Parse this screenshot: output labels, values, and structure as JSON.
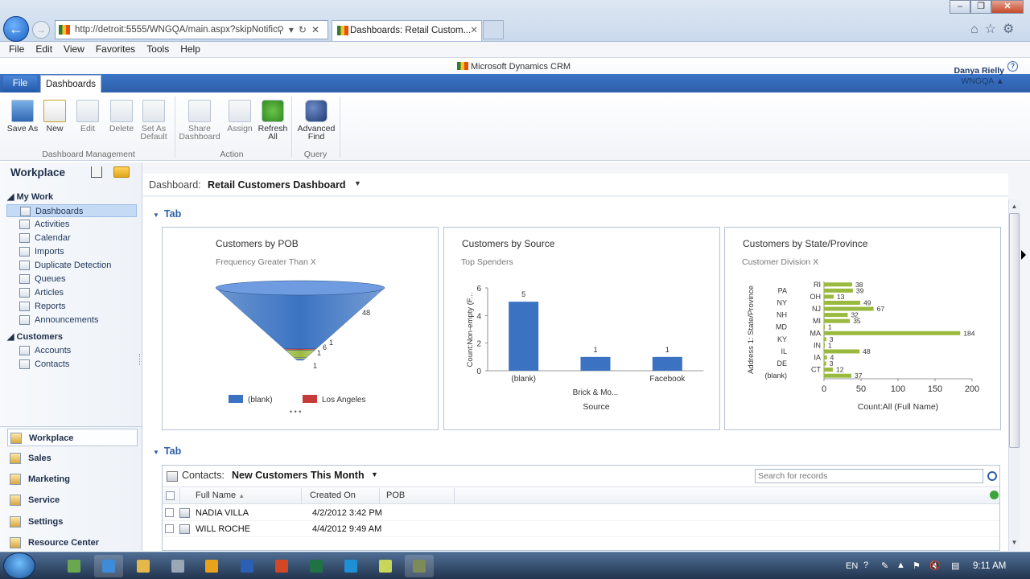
{
  "browser": {
    "url": "http://detroit:5555/WNGQA/main.aspx?skipNotific:",
    "tab_title": "Dashboards: Retail Custom...",
    "menu": [
      "File",
      "Edit",
      "View",
      "Favorites",
      "Tools",
      "Help"
    ]
  },
  "crm": {
    "brand": "Microsoft Dynamics CRM",
    "user_name": "Danya Rielly",
    "org": "WNGQA",
    "ribbon_tabs": {
      "file": "File",
      "dashboards": "Dashboards"
    },
    "ribbon_buttons": [
      {
        "label": "Save As",
        "enabled": true
      },
      {
        "label": "New",
        "enabled": true
      },
      {
        "label": "Edit",
        "enabled": false
      },
      {
        "label": "Delete",
        "enabled": false
      },
      {
        "label": "Set As Default",
        "enabled": false
      },
      {
        "label": "Share Dashboard",
        "enabled": false
      },
      {
        "label": "Assign",
        "enabled": false
      },
      {
        "label": "Refresh All",
        "enabled": true
      },
      {
        "label": "Advanced Find",
        "enabled": true
      }
    ],
    "ribbon_groups": [
      "Dashboard Management",
      "Action",
      "Query"
    ]
  },
  "nav": {
    "title": "Workplace",
    "sections": [
      {
        "name": "My Work",
        "items": [
          "Dashboards",
          "Activities",
          "Calendar",
          "Imports",
          "Duplicate Detection",
          "Queues",
          "Articles",
          "Reports",
          "Announcements"
        ]
      },
      {
        "name": "Customers",
        "items": [
          "Accounts",
          "Contacts"
        ]
      }
    ],
    "selected_item": "Dashboards",
    "areas": [
      "Workplace",
      "Sales",
      "Marketing",
      "Service",
      "Settings",
      "Resource Center"
    ]
  },
  "dashboard": {
    "label": "Dashboard:",
    "name": "Retail Customers Dashboard",
    "tab1": "Tab",
    "tab2": "Tab"
  },
  "chart_data": [
    {
      "type": "funnel",
      "title": "Customers by POB",
      "subtitle": "Frequency Greater Than X",
      "categories": [
        "(blank)",
        "Los Angeles",
        "",
        "",
        ""
      ],
      "values": [
        48,
        1,
        6,
        1,
        1
      ],
      "legend": [
        "(blank)",
        "Los Angeles"
      ],
      "colors": [
        "#3b73c2",
        "#c73a3a",
        "#9aba3f",
        "#d6d14a",
        "#5b8fd6"
      ],
      "more_indicator": "• • •"
    },
    {
      "type": "bar",
      "title": "Customers by Source",
      "subtitle": "Top Spenders",
      "categories": [
        "(blank)",
        "Brick & Mo...",
        "Facebook"
      ],
      "values": [
        5,
        1,
        1
      ],
      "xlabel": "Source",
      "ylabel": "Count:Non-empty (F...",
      "ylim": [
        0,
        6
      ],
      "yticks": [
        0,
        2,
        4,
        6
      ],
      "color": "#3b73c2"
    },
    {
      "type": "bar-horizontal",
      "title": "Customers by State/Province",
      "subtitle": "Customer Division X",
      "categories": [
        "RI",
        "PA",
        "OH",
        "NY",
        "NJ",
        "NH",
        "MI",
        "MD",
        "MA",
        "KY",
        "IN",
        "IL",
        "IA",
        "DE",
        "CT",
        "(blank)"
      ],
      "values": [
        38,
        39,
        13,
        49,
        67,
        32,
        35,
        1,
        184,
        3,
        1,
        48,
        4,
        3,
        12,
        37
      ],
      "xlabel": "Count:All (Full Name)",
      "ylabel": "Address 1: State/Province",
      "xlim": [
        0,
        200
      ],
      "xticks": [
        0,
        50,
        100,
        150,
        200
      ],
      "color": "#9aba3f"
    }
  ],
  "list": {
    "entity_label": "Contacts:",
    "view_name": "New Customers This Month",
    "search_placeholder": "Search for records",
    "columns": [
      "Full Name",
      "Created On",
      "POB"
    ],
    "rows": [
      {
        "full_name": "NADIA VILLA",
        "created_on": "4/2/2012 3:42 PM",
        "pob": ""
      },
      {
        "full_name": "WILL ROCHE",
        "created_on": "4/4/2012 9:49 AM",
        "pob": ""
      }
    ]
  },
  "taskbar": {
    "lang": "EN",
    "time": "9:11 AM",
    "apps": [
      {
        "name": "people-icon",
        "color": "#6aa84f"
      },
      {
        "name": "ie-icon",
        "color": "#3d8bd9"
      },
      {
        "name": "folder-icon",
        "color": "#e5b84b"
      },
      {
        "name": "calc-icon",
        "color": "#9aa7b5"
      },
      {
        "name": "outlook-icon",
        "color": "#e8a21c"
      },
      {
        "name": "word-icon",
        "color": "#2b5fb4"
      },
      {
        "name": "powerpoint-icon",
        "color": "#d24726"
      },
      {
        "name": "excel-icon",
        "color": "#207245"
      },
      {
        "name": "lync-icon",
        "color": "#1f8fd6"
      },
      {
        "name": "notes-icon",
        "color": "#c8d65a"
      },
      {
        "name": "tool-icon",
        "color": "#7d8b58"
      }
    ]
  }
}
